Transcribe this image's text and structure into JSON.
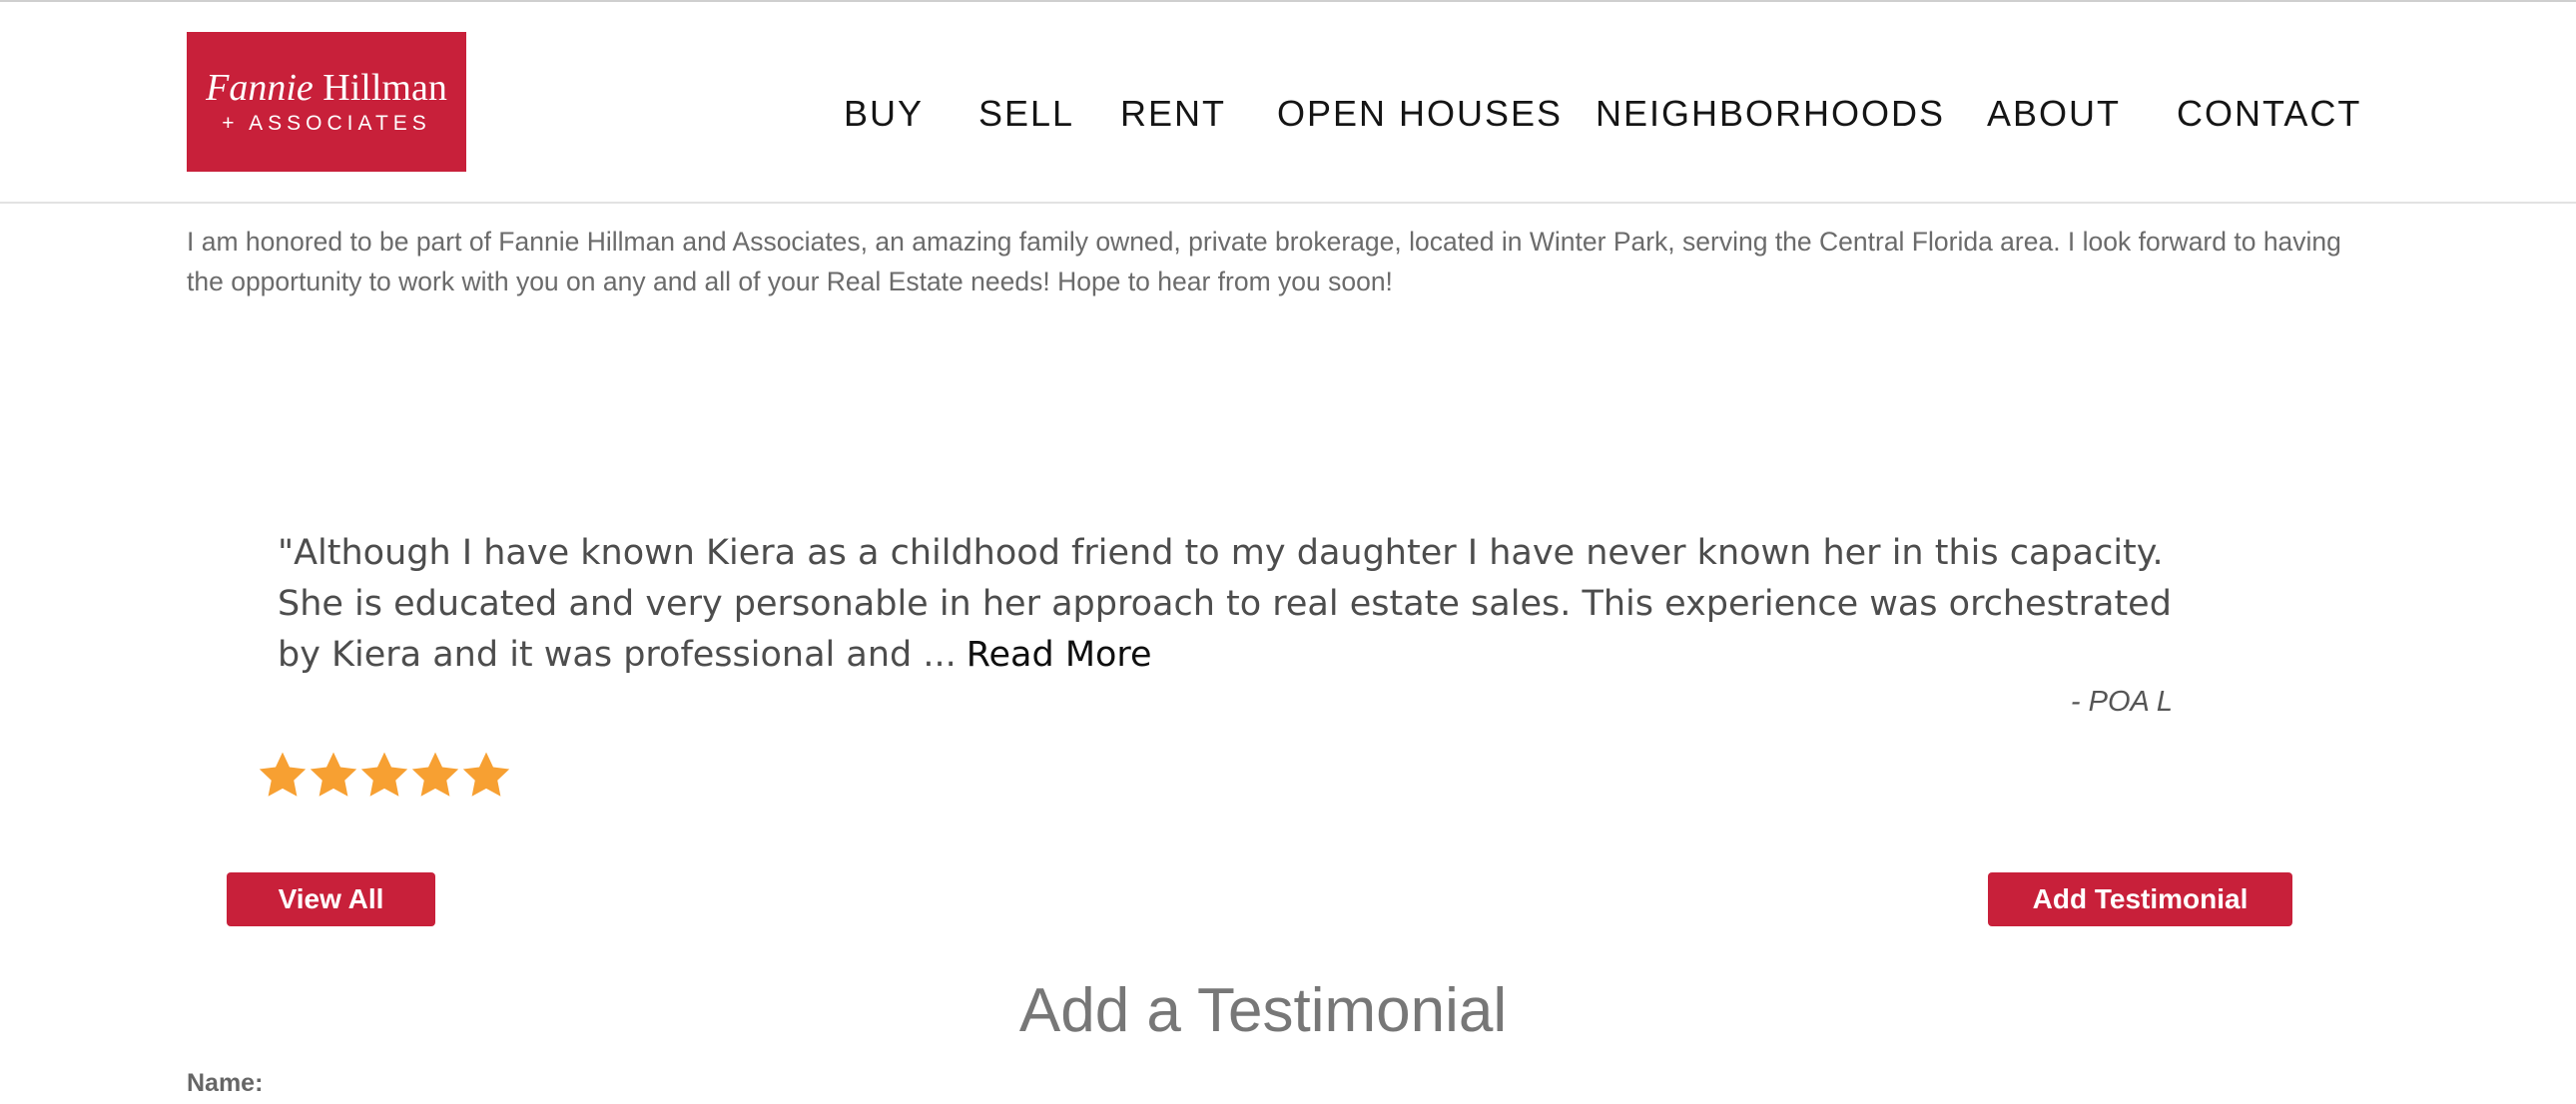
{
  "brand": {
    "name_italic": "Fannie",
    "name_rest": "Hillman",
    "sub": "+ ASSOCIATES",
    "color": "#c8203a"
  },
  "nav": {
    "items": [
      "BUY",
      "SELL",
      "RENT",
      "OPEN HOUSES",
      "NEIGHBORHOODS",
      "ABOUT",
      "CONTACT"
    ]
  },
  "intro": {
    "text": "I am honored to be part of Fannie Hillman and Associates, an amazing family owned, private brokerage, located in Winter Park, serving the Central Florida area. I look forward to having the opportunity to work with you on any and all of your Real Estate needs! Hope to hear from you soon!"
  },
  "testimonial": {
    "quote": "\"Although I have known Kiera as a childhood friend to my daughter I have never known her in this capacity. She is educated and very personable in her approach to real estate sales. This experience was orchestrated by Kiera and it was professional and ...",
    "read_more": "Read More",
    "author": "- POA L",
    "rating": 5,
    "rating_max": 5,
    "star_color": "#f7a032"
  },
  "buttons": {
    "view_all": "View All",
    "add_testimonial": "Add Testimonial"
  },
  "form": {
    "title": "Add a Testimonial",
    "name_label": "Name:"
  }
}
